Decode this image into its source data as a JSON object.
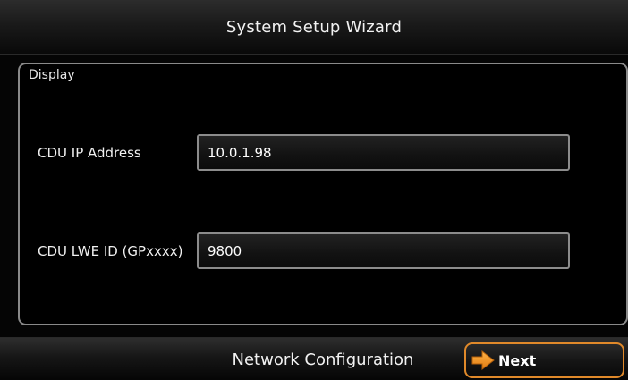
{
  "header": {
    "title": "System Setup Wizard"
  },
  "panel": {
    "legend": "Display",
    "fields": [
      {
        "label": "CDU IP Address",
        "value": "10.0.1.98"
      },
      {
        "label": "CDU LWE ID (GPxxxx)",
        "value": "9800"
      }
    ]
  },
  "footer": {
    "step_title": "Network Configuration",
    "next_label": "Next",
    "next_icon": "arrow-right-icon",
    "accent_color": "#e0892a"
  }
}
